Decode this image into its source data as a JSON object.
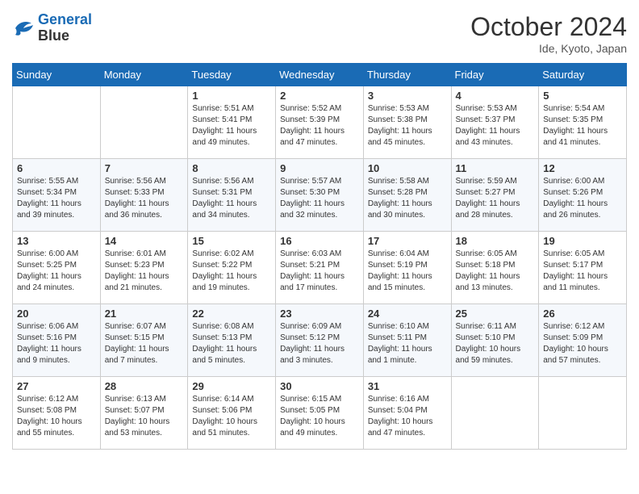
{
  "header": {
    "logo_line1": "General",
    "logo_line2": "Blue",
    "month": "October 2024",
    "location": "Ide, Kyoto, Japan"
  },
  "days_of_week": [
    "Sunday",
    "Monday",
    "Tuesday",
    "Wednesday",
    "Thursday",
    "Friday",
    "Saturday"
  ],
  "weeks": [
    [
      {
        "day": "",
        "info": ""
      },
      {
        "day": "",
        "info": ""
      },
      {
        "day": "1",
        "info": "Sunrise: 5:51 AM\nSunset: 5:41 PM\nDaylight: 11 hours and 49 minutes."
      },
      {
        "day": "2",
        "info": "Sunrise: 5:52 AM\nSunset: 5:39 PM\nDaylight: 11 hours and 47 minutes."
      },
      {
        "day": "3",
        "info": "Sunrise: 5:53 AM\nSunset: 5:38 PM\nDaylight: 11 hours and 45 minutes."
      },
      {
        "day": "4",
        "info": "Sunrise: 5:53 AM\nSunset: 5:37 PM\nDaylight: 11 hours and 43 minutes."
      },
      {
        "day": "5",
        "info": "Sunrise: 5:54 AM\nSunset: 5:35 PM\nDaylight: 11 hours and 41 minutes."
      }
    ],
    [
      {
        "day": "6",
        "info": "Sunrise: 5:55 AM\nSunset: 5:34 PM\nDaylight: 11 hours and 39 minutes."
      },
      {
        "day": "7",
        "info": "Sunrise: 5:56 AM\nSunset: 5:33 PM\nDaylight: 11 hours and 36 minutes."
      },
      {
        "day": "8",
        "info": "Sunrise: 5:56 AM\nSunset: 5:31 PM\nDaylight: 11 hours and 34 minutes."
      },
      {
        "day": "9",
        "info": "Sunrise: 5:57 AM\nSunset: 5:30 PM\nDaylight: 11 hours and 32 minutes."
      },
      {
        "day": "10",
        "info": "Sunrise: 5:58 AM\nSunset: 5:28 PM\nDaylight: 11 hours and 30 minutes."
      },
      {
        "day": "11",
        "info": "Sunrise: 5:59 AM\nSunset: 5:27 PM\nDaylight: 11 hours and 28 minutes."
      },
      {
        "day": "12",
        "info": "Sunrise: 6:00 AM\nSunset: 5:26 PM\nDaylight: 11 hours and 26 minutes."
      }
    ],
    [
      {
        "day": "13",
        "info": "Sunrise: 6:00 AM\nSunset: 5:25 PM\nDaylight: 11 hours and 24 minutes."
      },
      {
        "day": "14",
        "info": "Sunrise: 6:01 AM\nSunset: 5:23 PM\nDaylight: 11 hours and 21 minutes."
      },
      {
        "day": "15",
        "info": "Sunrise: 6:02 AM\nSunset: 5:22 PM\nDaylight: 11 hours and 19 minutes."
      },
      {
        "day": "16",
        "info": "Sunrise: 6:03 AM\nSunset: 5:21 PM\nDaylight: 11 hours and 17 minutes."
      },
      {
        "day": "17",
        "info": "Sunrise: 6:04 AM\nSunset: 5:19 PM\nDaylight: 11 hours and 15 minutes."
      },
      {
        "day": "18",
        "info": "Sunrise: 6:05 AM\nSunset: 5:18 PM\nDaylight: 11 hours and 13 minutes."
      },
      {
        "day": "19",
        "info": "Sunrise: 6:05 AM\nSunset: 5:17 PM\nDaylight: 11 hours and 11 minutes."
      }
    ],
    [
      {
        "day": "20",
        "info": "Sunrise: 6:06 AM\nSunset: 5:16 PM\nDaylight: 11 hours and 9 minutes."
      },
      {
        "day": "21",
        "info": "Sunrise: 6:07 AM\nSunset: 5:15 PM\nDaylight: 11 hours and 7 minutes."
      },
      {
        "day": "22",
        "info": "Sunrise: 6:08 AM\nSunset: 5:13 PM\nDaylight: 11 hours and 5 minutes."
      },
      {
        "day": "23",
        "info": "Sunrise: 6:09 AM\nSunset: 5:12 PM\nDaylight: 11 hours and 3 minutes."
      },
      {
        "day": "24",
        "info": "Sunrise: 6:10 AM\nSunset: 5:11 PM\nDaylight: 11 hours and 1 minute."
      },
      {
        "day": "25",
        "info": "Sunrise: 6:11 AM\nSunset: 5:10 PM\nDaylight: 10 hours and 59 minutes."
      },
      {
        "day": "26",
        "info": "Sunrise: 6:12 AM\nSunset: 5:09 PM\nDaylight: 10 hours and 57 minutes."
      }
    ],
    [
      {
        "day": "27",
        "info": "Sunrise: 6:12 AM\nSunset: 5:08 PM\nDaylight: 10 hours and 55 minutes."
      },
      {
        "day": "28",
        "info": "Sunrise: 6:13 AM\nSunset: 5:07 PM\nDaylight: 10 hours and 53 minutes."
      },
      {
        "day": "29",
        "info": "Sunrise: 6:14 AM\nSunset: 5:06 PM\nDaylight: 10 hours and 51 minutes."
      },
      {
        "day": "30",
        "info": "Sunrise: 6:15 AM\nSunset: 5:05 PM\nDaylight: 10 hours and 49 minutes."
      },
      {
        "day": "31",
        "info": "Sunrise: 6:16 AM\nSunset: 5:04 PM\nDaylight: 10 hours and 47 minutes."
      },
      {
        "day": "",
        "info": ""
      },
      {
        "day": "",
        "info": ""
      }
    ]
  ]
}
